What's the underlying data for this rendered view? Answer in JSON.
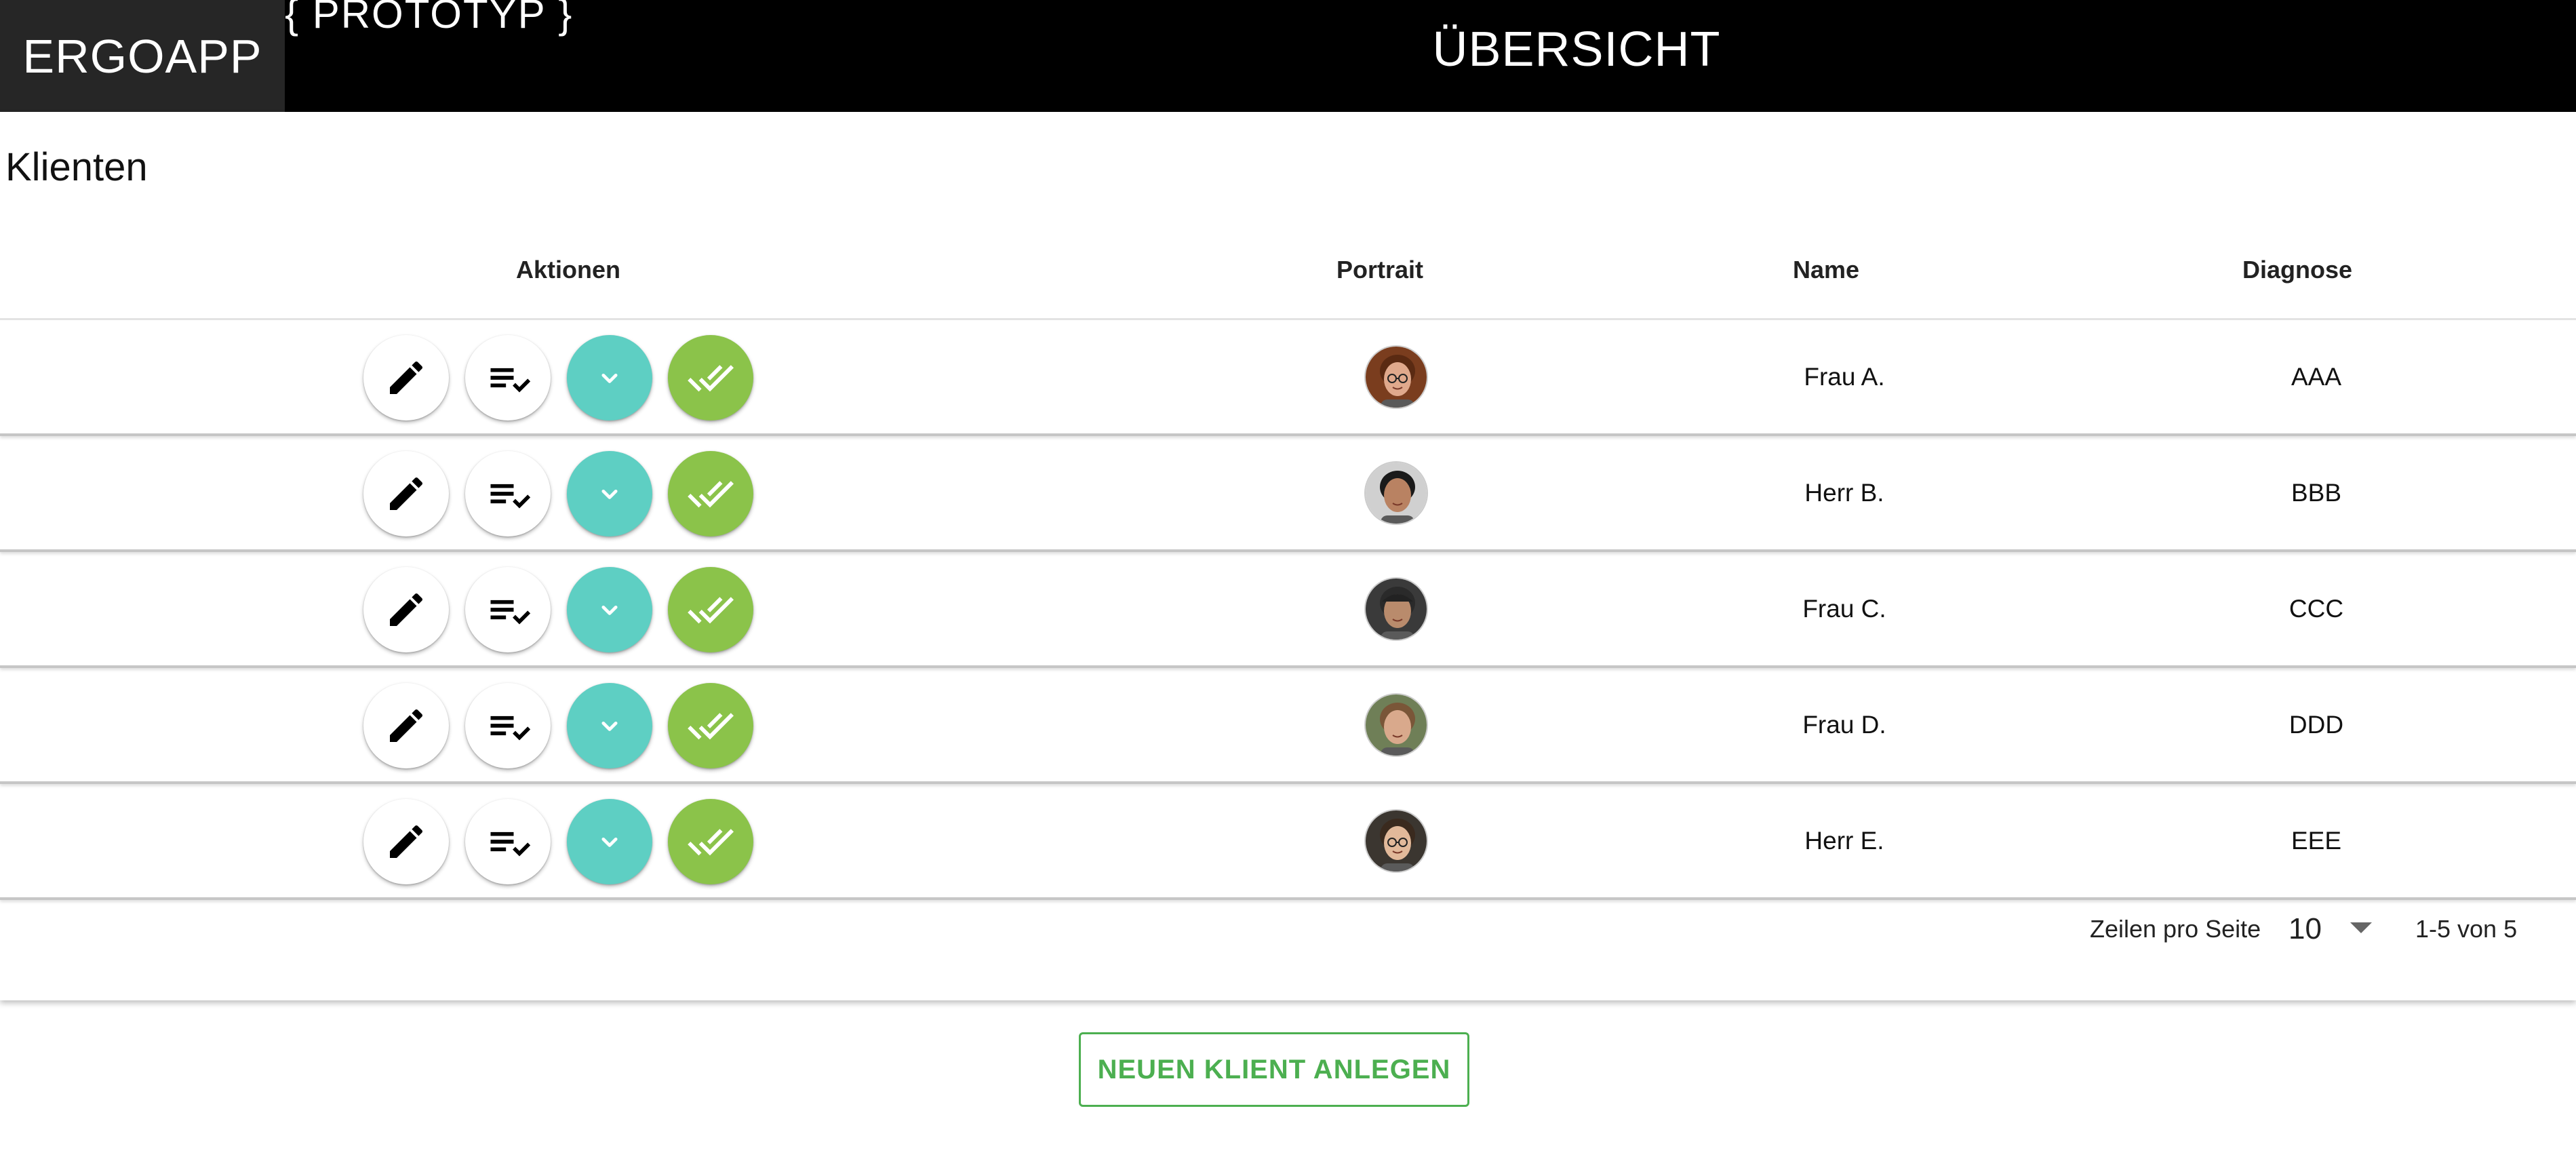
{
  "appbar": {
    "brand": "ERGOAPP",
    "badge": "{ PROTOTYP }",
    "title": "ÜBERSICHT"
  },
  "card": {
    "title": "Klienten",
    "columns": {
      "actions": "Aktionen",
      "portrait": "Portrait",
      "name": "Name",
      "diagnosis": "Diagnose"
    },
    "rows": [
      {
        "name": "Frau A.",
        "diagnosis": "AAA",
        "avatar": "portrait-woman-glasses"
      },
      {
        "name": "Herr B.",
        "diagnosis": "BBB",
        "avatar": "portrait-man-smiling"
      },
      {
        "name": "Frau C.",
        "diagnosis": "CCC",
        "avatar": "portrait-man-cap"
      },
      {
        "name": "Frau D.",
        "diagnosis": "DDD",
        "avatar": "portrait-woman-outdoor"
      },
      {
        "name": "Herr E.",
        "diagnosis": "EEE",
        "avatar": "portrait-man-glasses"
      }
    ],
    "row_actions": [
      "edit-icon",
      "checklist-icon",
      "chevron-down-icon",
      "done-all-icon"
    ],
    "footer": {
      "rows_per_page_label": "Zeilen pro Seite",
      "rows_per_page_value": "10",
      "range": "1-5 von 5"
    }
  },
  "new_client_button": "NEUEN KLIENT ANLEGEN",
  "colors": {
    "appbar": "#000000",
    "brand_bg": "#262626",
    "teal": "#5ecfc3",
    "green": "#8bc34a",
    "button_accent": "#4caf50"
  }
}
